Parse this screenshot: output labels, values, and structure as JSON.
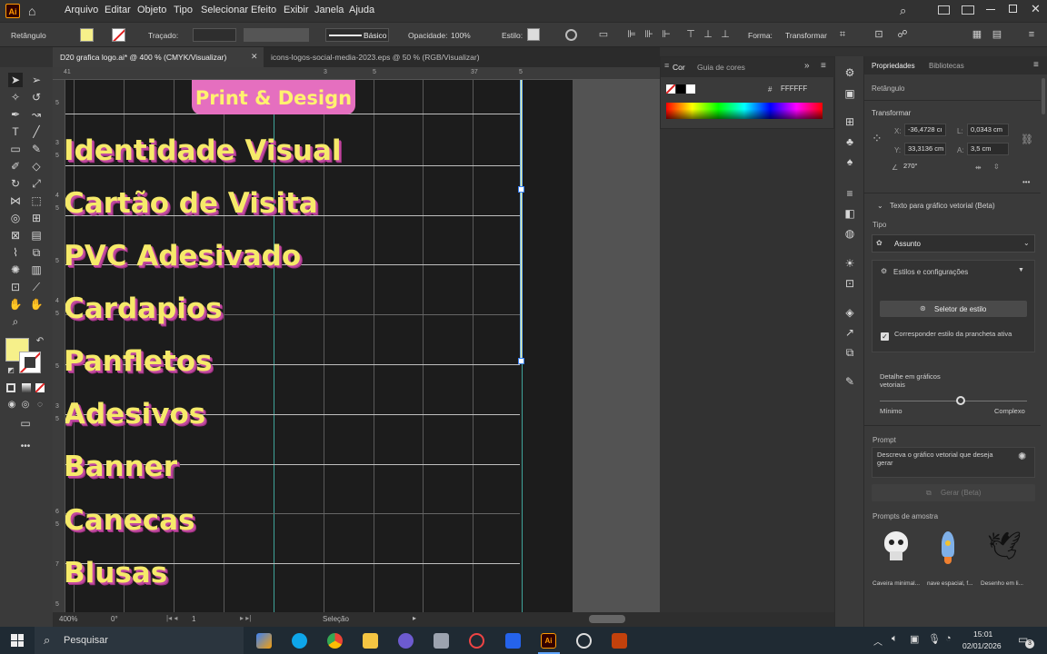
{
  "app": {
    "logo": "Ai"
  },
  "menu": [
    "Arquivo",
    "Editar",
    "Objeto",
    "Tipo",
    "Selecionar",
    "Efeito",
    "Exibir",
    "Janela",
    "Ajuda"
  ],
  "control": {
    "object_type": "Retângulo",
    "stroke_label": "Traçado:",
    "stroke_style": "Básico",
    "opacity_label": "Opacidade:",
    "opacity_value": "100%",
    "styles_label": "Estilo:",
    "shape_label": "Forma:",
    "transform_label": "Transformar",
    "fill_color": "#f6f08a"
  },
  "tabs": [
    {
      "label": "D20 grafica logo.ai* @ 400 % (CMYK/Visualizar)"
    },
    {
      "label": "icons-logos-social-media-2023.eps @ 50 % (RGB/Visualizar)"
    }
  ],
  "ruler": {
    "top": [
      "41",
      "3",
      "5",
      "37",
      "5"
    ],
    "left": [
      "5",
      "3",
      "5",
      "4",
      "5",
      "5",
      "4",
      "5",
      "5",
      "3",
      "5",
      "6",
      "5",
      "7",
      "5"
    ]
  },
  "canvas": {
    "badge": "Print & Design",
    "services": [
      "Identidade Visual",
      "Cartão de Visita",
      "PVC Adesivado",
      "Cardapios",
      "Panfletos",
      "Adesivos",
      "Banner",
      "Canecas",
      "Blusas"
    ]
  },
  "color_panel": {
    "tab_cor": "Cor",
    "tab_guia": "Guia de cores",
    "hex_prefix": "#",
    "hex_value": "FFFFFF"
  },
  "properties": {
    "tab_props": "Propriedades",
    "tab_libs": "Bibliotecas",
    "object": "Retângulo",
    "transform_title": "Transformar",
    "x_label": "X:",
    "x_value": "-36,4728 cı",
    "y_label": "Y:",
    "y_value": "33,3136 cm",
    "w_label": "L:",
    "w_value": "0,0343 cm",
    "h_label": "A:",
    "h_value": "3,5 cm",
    "angle": "270°",
    "section": "Texto para gráfico vetorial (Beta)",
    "type_label": "Tipo",
    "type_value": "Assunto",
    "styles_title": "Estilos e configurações",
    "style_picker": "Seletor de estilo",
    "match_style": "Corresponder estilo da prancheta ativa",
    "detail_label": "Detalhe em gráficos vetoriais",
    "detail_min": "Mínimo",
    "detail_max": "Complexo",
    "detail_value": 0.55,
    "prompt_label": "Prompt",
    "prompt_placeholder": "Descreva o gráfico vetorial que deseja gerar",
    "generate": "Gerar (Beta)",
    "samples_label": "Prompts de amostra",
    "samples": [
      "Caveira minimal...",
      "nave espacial, f...",
      "Desenho em li..."
    ]
  },
  "status": {
    "zoom": "400%",
    "rotation": "0°",
    "artboard": "1",
    "tool": "Seleção"
  },
  "taskbar": {
    "search": "Pesquisar",
    "time": "15:01",
    "date": "02/01/2026",
    "notifications": "3"
  }
}
